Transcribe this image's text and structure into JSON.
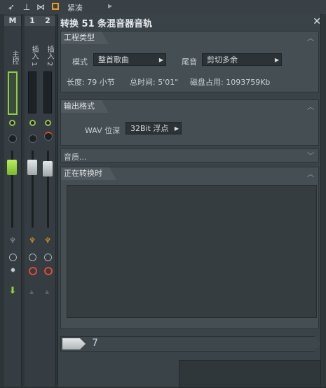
{
  "toolbar": {
    "label": "紧凑"
  },
  "mixer": {
    "strips": [
      {
        "num": "M",
        "name": "主控"
      },
      {
        "num": "1",
        "name": "插入 1"
      },
      {
        "num": "2",
        "name": "插入 2"
      }
    ]
  },
  "dialog": {
    "title": "转换 51 条混音器音轨",
    "project": {
      "header": "工程类型",
      "mode_label": "模式",
      "mode_value": "整首歌曲",
      "tail_label": "尾音",
      "tail_value": "剪切多余",
      "length": "长度: 79 小节",
      "total_time": "总时间: 5'01\"",
      "disk": "磁盘占用: 1093759Kb"
    },
    "output": {
      "header": "输出格式",
      "wav_label": "WAV 位深",
      "wav_value": "32Bit 浮点"
    },
    "quality": {
      "header": "音质..."
    },
    "converting": {
      "header": "正在转换时"
    },
    "progress": {
      "value": 0.09,
      "text": "7"
    }
  },
  "colors": {
    "accent_green": "#8fcf3a",
    "accent_orange": "#e8a020",
    "record_red": "#e04a30"
  }
}
